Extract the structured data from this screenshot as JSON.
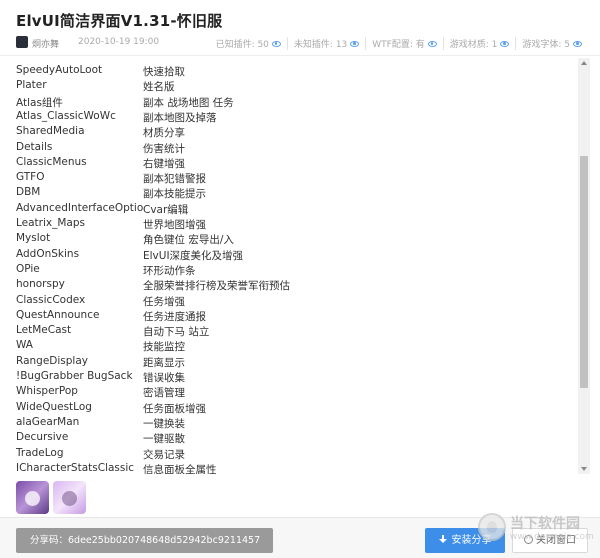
{
  "header": {
    "title": "ElvUI简洁界面V1.31-怀旧服",
    "author": "炯亦舞",
    "date": "2020-10-19 19:00",
    "stats": [
      {
        "label": "已知插件: 50",
        "icon": "eye-icon"
      },
      {
        "label": "未知插件: 13",
        "icon": "eye-icon"
      },
      {
        "label": "WTF配置: 有",
        "icon": "eye-icon"
      },
      {
        "label": "游戏材质: 1",
        "icon": "eye-icon"
      },
      {
        "label": "游戏字体: 5",
        "icon": "eye-icon"
      }
    ]
  },
  "addons": [
    {
      "name": "SpeedyAutoLoot",
      "desc": "快速拾取"
    },
    {
      "name": "Plater",
      "desc": "姓名版"
    },
    {
      "name": "Atlas组件",
      "desc": "副本 战场地图 任务"
    },
    {
      "name": "Atlas_ClassicWoWc",
      "desc": "副本地图及掉落"
    },
    {
      "name": "SharedMedia",
      "desc": "材质分享"
    },
    {
      "name": "Details",
      "desc": "伤害统计"
    },
    {
      "name": "ClassicMenus",
      "desc": "右键增强"
    },
    {
      "name": "GTFO",
      "desc": "副本犯错警报"
    },
    {
      "name": "DBM",
      "desc": "副本技能提示"
    },
    {
      "name": "AdvancedInterfaceOptions",
      "desc": "Cvar编辑"
    },
    {
      "name": "Leatrix_Maps",
      "desc": "世界地图增强"
    },
    {
      "name": "Myslot",
      "desc": "角色键位 宏导出/入"
    },
    {
      "name": "AddOnSkins",
      "desc": "ElvUI深度美化及增强"
    },
    {
      "name": "OPie",
      "desc": "环形动作条"
    },
    {
      "name": "honorspy",
      "desc": "全服荣誉排行榜及荣誉军衔预估"
    },
    {
      "name": "ClassicCodex",
      "desc": "任务增强"
    },
    {
      "name": "QuestAnnounce",
      "desc": "任务进度通报"
    },
    {
      "name": "LetMeCast",
      "desc": "自动下马 站立"
    },
    {
      "name": "WA",
      "desc": "技能监控"
    },
    {
      "name": "RangeDisplay",
      "desc": "距离显示"
    },
    {
      "name": "!BugGrabber BugSack",
      "desc": "错误收集"
    },
    {
      "name": "WhisperPop",
      "desc": "密语管理"
    },
    {
      "name": "WideQuestLog",
      "desc": "任务面板增强"
    },
    {
      "name": "alaGearMan",
      "desc": "一键换装"
    },
    {
      "name": "Decursive",
      "desc": "一键驱散"
    },
    {
      "name": "TradeLog",
      "desc": "交易记录"
    },
    {
      "name": "ICharacterStatsClassic",
      "desc": "信息面板全属性"
    }
  ],
  "footer": {
    "share_code": "分享码：6dee25bb020748648d52942bc9211457",
    "install_label": "安装分享",
    "close_label": "关闭窗口"
  },
  "watermark": {
    "text": "当下软件园",
    "url": "www.downxia.com"
  },
  "colors": {
    "accent": "#3d8ee8",
    "share_bg": "#9a9a9a"
  }
}
